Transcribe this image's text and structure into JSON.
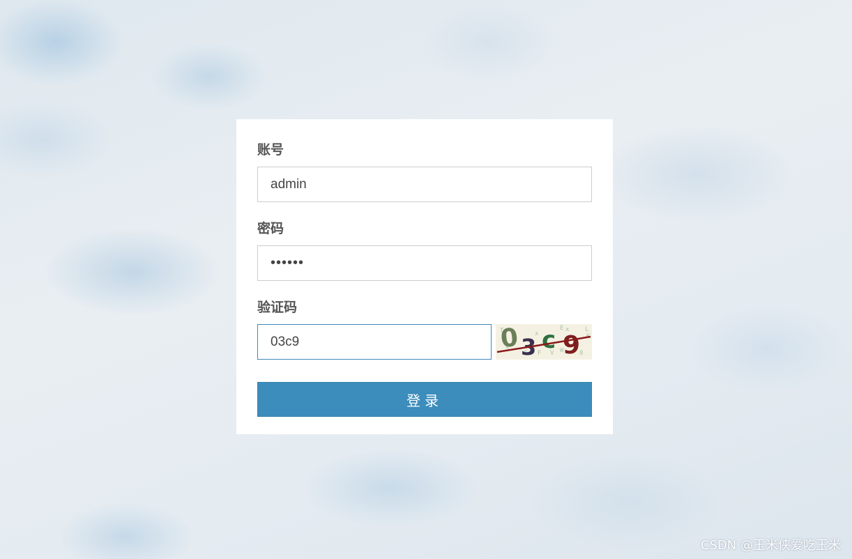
{
  "login": {
    "account_label": "账号",
    "account_value": "admin",
    "password_label": "密码",
    "password_value": "••••••",
    "captcha_label": "验证码",
    "captcha_value": "03c9",
    "captcha_image_text": "03c9",
    "submit_label": "登录"
  },
  "watermark": "CSDN @玉米侠爱吃玉米",
  "colors": {
    "button_bg": "#3c8dbc",
    "card_bg": "#ffffff",
    "label_text": "#555555",
    "input_border": "#cccccc",
    "focused_border": "#3d8ab8"
  }
}
